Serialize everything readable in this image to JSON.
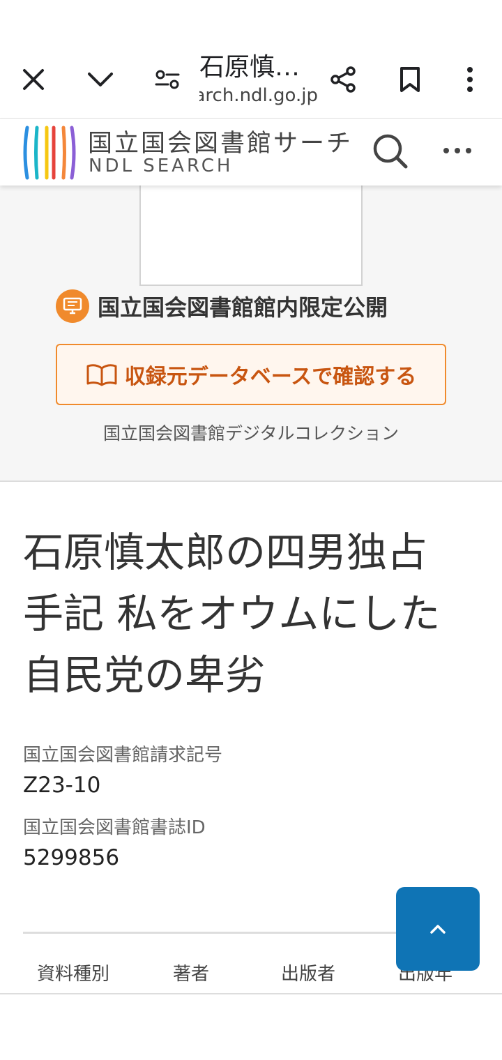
{
  "browser": {
    "page_title": "石原慎…",
    "url_host": "search.ndl.go.jp",
    "close_icon": "close-icon",
    "dropdown_icon": "chevron-down-icon",
    "tune_icon": "site-settings-icon",
    "share_icon": "share-icon",
    "bookmark_icon": "bookmark-icon",
    "menu_icon": "more-vert-icon"
  },
  "header": {
    "logo_jp": "国立国会図書館サーチ",
    "logo_en": "NDL SEARCH",
    "search_icon": "search-icon",
    "more_icon": "more-horiz-icon",
    "logo_colors": [
      "#2b8fe0",
      "#1bb5c8",
      "#f6c712",
      "#e6433b",
      "#f4873a",
      "#8b5fd6"
    ]
  },
  "preview": {
    "restriction_label": "国立国会図書館館内限定公開",
    "db_button_label": "収録元データベースで確認する",
    "collection_name": "国立国会図書館デジタルコレクション",
    "accent_color": "#f08a2c"
  },
  "record": {
    "title_lines": [
      "石原慎太郎の四男独占",
      "手記 私をオウムにした",
      "自民党の卑劣"
    ],
    "call_number_label": "国立国会図書館請求記号",
    "call_number": "Z23-10",
    "bib_id_label": "国立国会図書館書誌ID",
    "bib_id": "5299856"
  },
  "tabs": [
    {
      "label": "資料種別"
    },
    {
      "label": "著者"
    },
    {
      "label": "出版者"
    },
    {
      "label": "出版年"
    }
  ],
  "back_to_top": {
    "icon": "chevron-up-icon",
    "color": "#0f74b5"
  }
}
